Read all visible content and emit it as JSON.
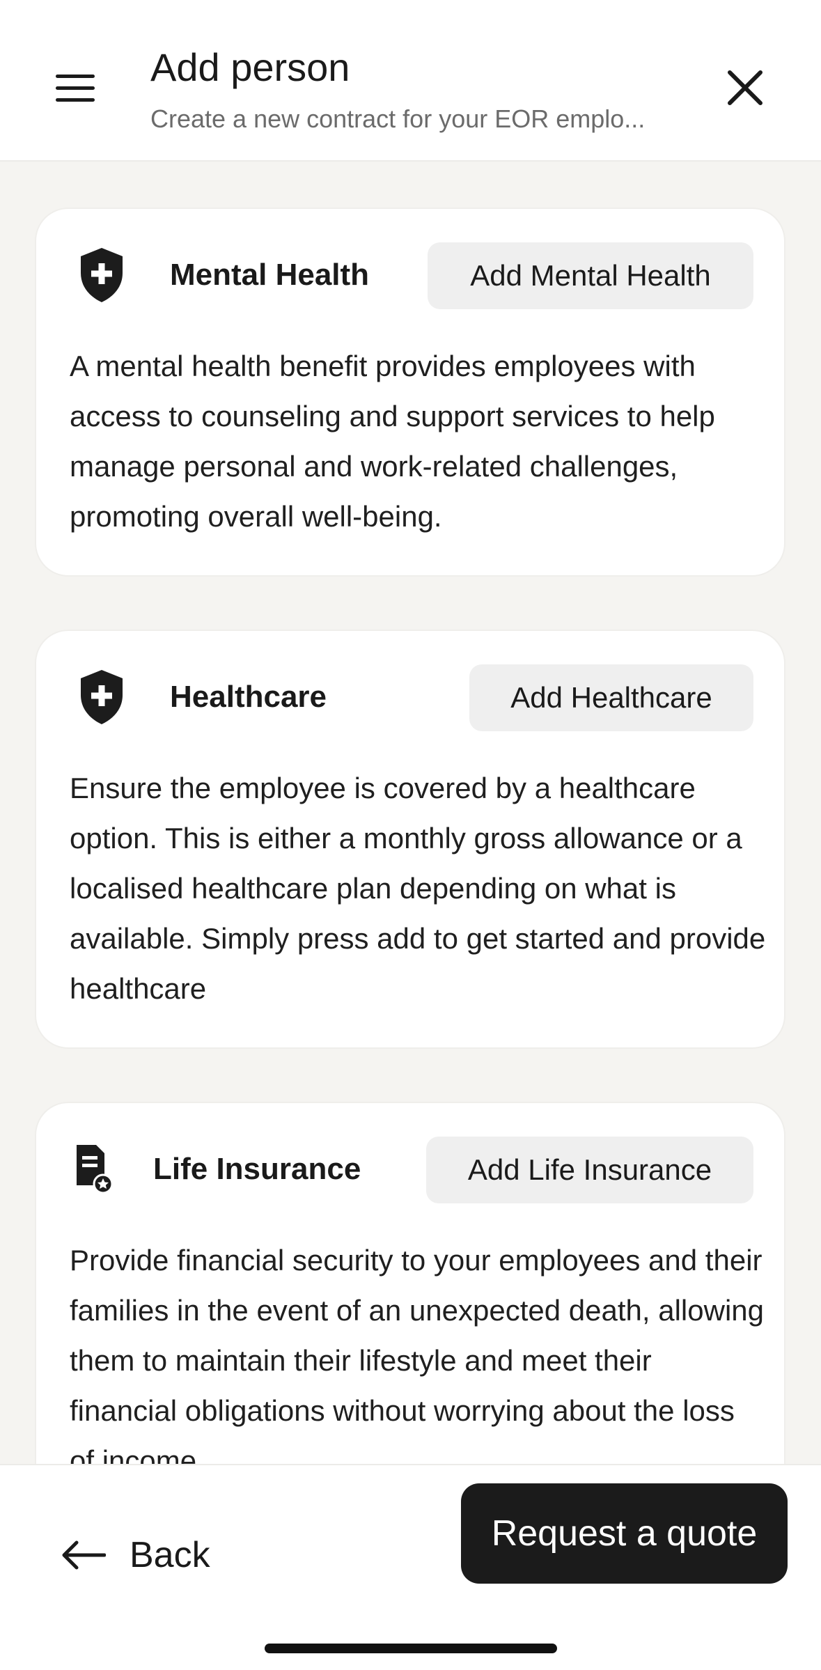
{
  "header": {
    "title": "Add person",
    "subtitle": "Create a new contract for your EOR emplo..."
  },
  "icons": {
    "menu": "hamburger-menu-icon",
    "close": "close-x-icon",
    "shield": "shield-plus-icon",
    "document": "document-badge-icon",
    "back": "arrow-left-icon"
  },
  "benefits": [
    {
      "title": "Mental Health",
      "button": "Add Mental Health",
      "description": "A mental health benefit provides employees with access to counseling and support services to help manage personal and work-related challenges, promoting overall well-being."
    },
    {
      "title": "Healthcare",
      "button": "Add Healthcare",
      "description": "Ensure the employee is covered by a healthcare option. This is either a monthly gross allowance or a localised healthcare plan depending on what is available. Simply press add to get started and provide healthcare"
    },
    {
      "title": "Life Insurance",
      "button": "Add Life Insurance",
      "description": "Provide financial security to your employees and their families in the event of an unexpected death, allowing them to maintain their lifestyle and meet their financial obligations without worrying about the loss of income."
    }
  ],
  "footer": {
    "back_label": "Back",
    "quote_label": "Request a quote"
  },
  "colors": {
    "background": "#f5f4f1",
    "primary_button": "#1b1b1b",
    "secondary_button": "#efefef"
  }
}
